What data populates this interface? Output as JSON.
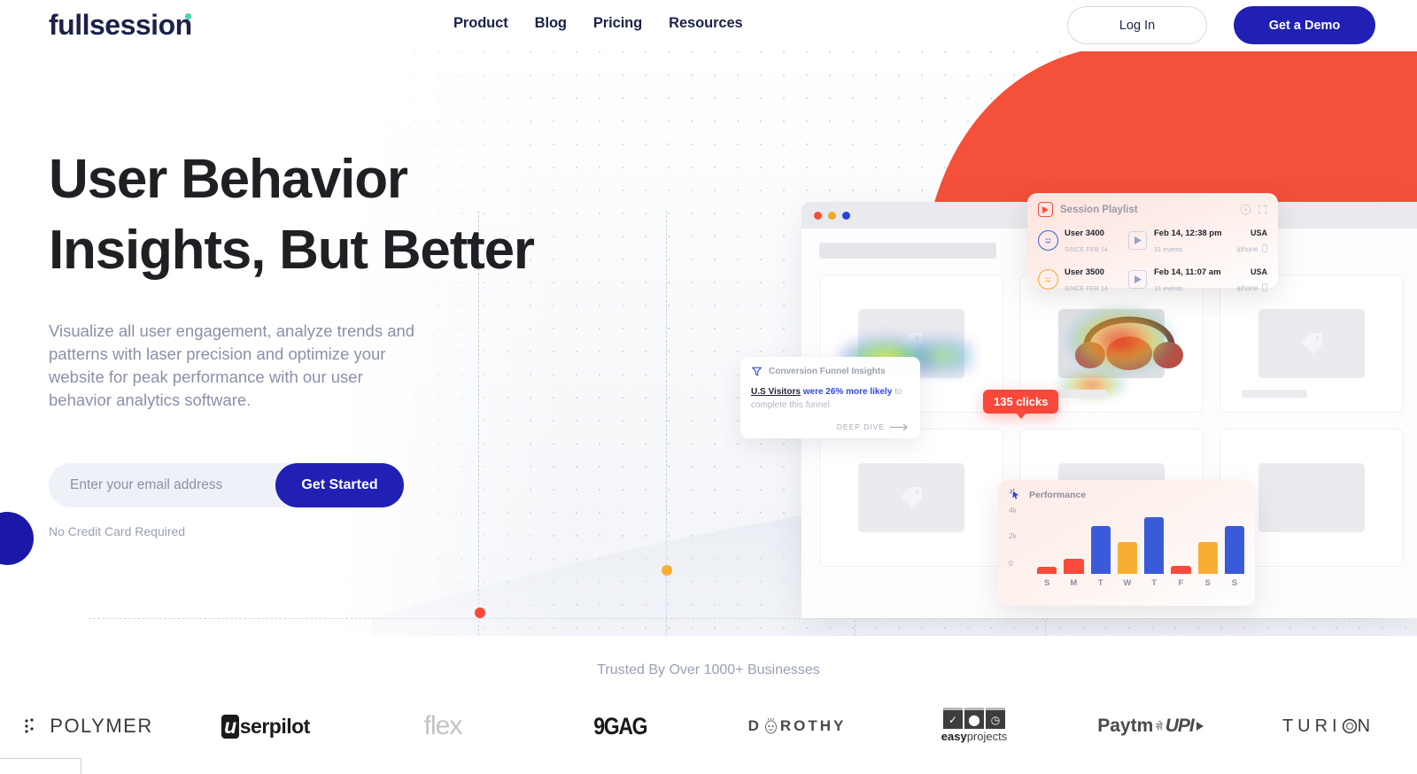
{
  "header": {
    "logo_text": "fullsession",
    "nav": [
      {
        "label": "Product"
      },
      {
        "label": "Blog"
      },
      {
        "label": "Pricing"
      },
      {
        "label": "Resources"
      }
    ],
    "login_label": "Log In",
    "demo_label": "Get a Demo"
  },
  "hero": {
    "headline_line1": "User Behavior",
    "headline_line2": "Insights, But Better",
    "subtext": "Visualize all user engagement, analyze trends and patterns with laser precision and optimize your website for peak performance with our user behavior analytics software.",
    "email_placeholder": "Enter your email address",
    "email_value": "",
    "cta_label": "Get Started",
    "note": "No Credit Card Required"
  },
  "session_playlist": {
    "title": "Session Playlist",
    "rows": [
      {
        "user": "User 3400",
        "since": "SINCE FEB 14",
        "date": "Feb 14, 12:38 pm",
        "events": "31 events",
        "country": "USA",
        "device": "iphone",
        "mood": "smile",
        "mood_color": "#3b5bdb"
      },
      {
        "user": "User 3500",
        "since": "SINCE FEB 14",
        "date": "Feb 14, 11:07 am",
        "events": "31 events",
        "country": "USA",
        "device": "iphone",
        "mood": "neutral",
        "mood_color": "#f2a93b"
      }
    ]
  },
  "funnel_card": {
    "title": "Conversion Funnel Insights",
    "text_underline": "U.S Visitors",
    "text_blue1": "were 26% more likely",
    "text_gray": "to complete this funnel",
    "link_label": "DEEP DIVE"
  },
  "clicks_badge": {
    "label": "135 clicks"
  },
  "chart_data": {
    "type": "bar",
    "title": "Performance",
    "categories": [
      "S",
      "M",
      "T",
      "W",
      "T",
      "F",
      "S",
      "S"
    ],
    "values": [
      600,
      1300,
      4200,
      2800,
      5000,
      700,
      2800,
      4200
    ],
    "colors": [
      "#f94a3c",
      "#f94a3c",
      "#3a5bd9",
      "#f9ae33",
      "#3a5bd9",
      "#f94a3c",
      "#f9ae33",
      "#3a5bd9"
    ],
    "ytick_labels": [
      "4k",
      "2k",
      "0"
    ],
    "ylim": [
      0,
      5600
    ],
    "xlabel": "",
    "ylabel": "",
    "grid": false,
    "legend": "none"
  },
  "trusted": {
    "title": "Trusted By Over 1000+ Businesses",
    "logos": [
      {
        "name": "POLYMER"
      },
      {
        "name": "userpilot"
      },
      {
        "name": "flex"
      },
      {
        "name": "9GAG"
      },
      {
        "name": "DOROTHY"
      },
      {
        "name": "easyprojects"
      },
      {
        "name": "Paytm UPI"
      },
      {
        "name": "TURION"
      }
    ]
  },
  "colors": {
    "brand_navy": "#1b2248",
    "brand_blue": "#2020b5",
    "accent_red": "#f4513b",
    "accent_teal": "#3ed6b4",
    "muted_text": "#8a90a8"
  }
}
